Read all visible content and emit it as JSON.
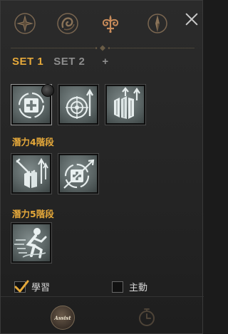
{
  "colors": {
    "accent": "#e6a93a",
    "inactive": "#8d8d8d",
    "text": "#d8d8d8"
  },
  "tabs": [
    {
      "icon": "compass-star-icon"
    },
    {
      "icon": "swirl-emblem-icon"
    },
    {
      "icon": "ornate-fleur-icon",
      "active": true
    },
    {
      "icon": "compass-needle-icon"
    }
  ],
  "close_icon": "close-icon",
  "set_tabs": {
    "set1": "SET 1",
    "set2": "SET 2",
    "add": "+"
  },
  "sections": {
    "tier4_label": "潛力4階段",
    "tier5_label": "潛力5階段"
  },
  "checkboxes": {
    "learn": {
      "label": "學習",
      "checked": true
    },
    "active": {
      "label": "主動",
      "checked": false
    }
  },
  "bottom": {
    "assist_label": "Assist",
    "timer_icon": "stopwatch-icon"
  }
}
